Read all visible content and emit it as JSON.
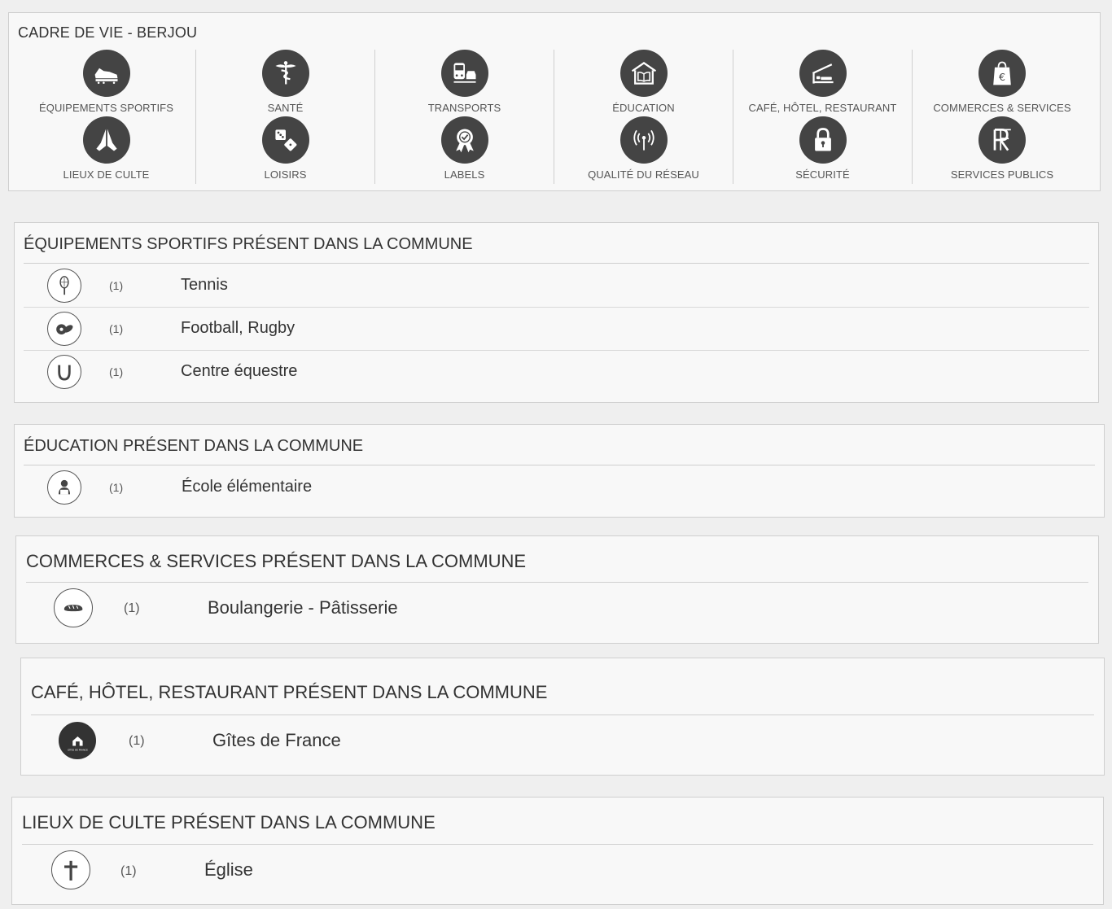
{
  "title": "CADRE DE VIE - BERJOU",
  "categories": [
    {
      "label": "ÉQUIPEMENTS SPORTIFS",
      "icon": "sports-shoe-icon"
    },
    {
      "label": "SANTÉ",
      "icon": "caduceus-icon"
    },
    {
      "label": "TRANSPORTS",
      "icon": "train-car-icon"
    },
    {
      "label": "ÉDUCATION",
      "icon": "school-book-icon"
    },
    {
      "label": "CAFÉ, HÔTEL, RESTAURANT",
      "icon": "hotel-bed-icon"
    },
    {
      "label": "COMMERCES & SERVICES",
      "icon": "shopping-bag-euro-icon"
    },
    {
      "label": "LIEUX DE CULTE",
      "icon": "praying-hands-icon"
    },
    {
      "label": "LOISIRS",
      "icon": "dice-icon"
    },
    {
      "label": "LABELS",
      "icon": "award-badge-icon"
    },
    {
      "label": "QUALITÉ DU RÉSEAU",
      "icon": "antenna-signal-icon"
    },
    {
      "label": "SÉCURITÉ",
      "icon": "padlock-icon"
    },
    {
      "label": "SERVICES PUBLICS",
      "icon": "rf-monogram-icon"
    }
  ],
  "sections": {
    "sports": {
      "title": "ÉQUIPEMENTS SPORTIFS PRÉSENT DANS LA COMMUNE",
      "items": [
        {
          "count": "(1)",
          "label": "Tennis",
          "icon": "tennis-racket-icon"
        },
        {
          "count": "(1)",
          "label": "Football, Rugby",
          "icon": "football-rugby-icon"
        },
        {
          "count": "(1)",
          "label": "Centre équestre",
          "icon": "horseshoe-icon"
        }
      ]
    },
    "education": {
      "title": "ÉDUCATION PRÉSENT DANS LA COMMUNE",
      "items": [
        {
          "count": "(1)",
          "label": "École élémentaire",
          "icon": "school-child-icon"
        }
      ]
    },
    "commerces": {
      "title": "COMMERCES & SERVICES PRÉSENT DANS LA COMMUNE",
      "items": [
        {
          "count": "(1)",
          "label": "Boulangerie - Pâtisserie",
          "icon": "bread-icon"
        }
      ]
    },
    "chr": {
      "title": "CAFÉ, HÔTEL, RESTAURANT PRÉSENT DANS LA COMMUNE",
      "items": [
        {
          "count": "(1)",
          "label": "Gîtes de France",
          "icon": "gites-de-france-logo",
          "logo_text": "GÎTES DE FRANCE"
        }
      ]
    },
    "culte": {
      "title": "LIEUX DE CULTE PRÉSENT DANS LA COMMUNE",
      "items": [
        {
          "count": "(1)",
          "label": "Église",
          "icon": "cross-icon"
        }
      ]
    }
  },
  "colors": {
    "icon_dark": "#444444",
    "border": "#cfcfcf",
    "background": "#efefef",
    "panel": "#f8f8f8"
  }
}
